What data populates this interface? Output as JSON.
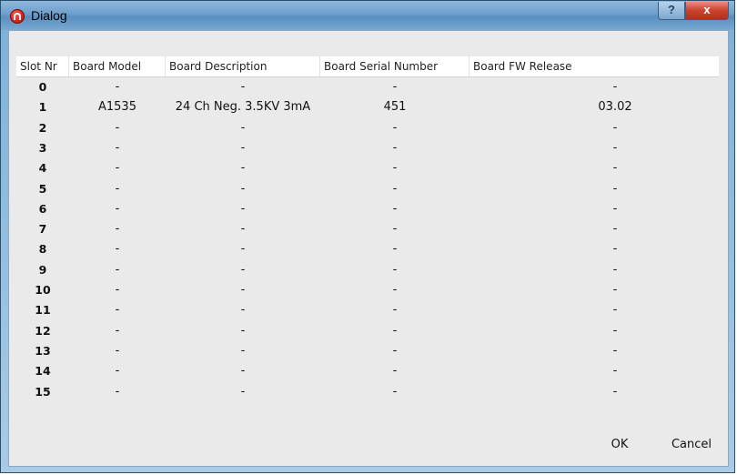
{
  "window": {
    "title": "Dialog",
    "help_label": "?",
    "close_label": "x"
  },
  "table": {
    "columns": [
      "Slot Nr",
      "Board Model",
      "Board Description",
      "Board Serial Number",
      "Board FW Release"
    ],
    "rows": [
      [
        "0",
        "-",
        "-",
        "-",
        "-"
      ],
      [
        "1",
        "A1535",
        "24 Ch Neg. 3.5KV 3mA",
        "451",
        "03.02"
      ],
      [
        "2",
        "-",
        "-",
        "-",
        "-"
      ],
      [
        "3",
        "-",
        "-",
        "-",
        "-"
      ],
      [
        "4",
        "-",
        "-",
        "-",
        "-"
      ],
      [
        "5",
        "-",
        "-",
        "-",
        "-"
      ],
      [
        "6",
        "-",
        "-",
        "-",
        "-"
      ],
      [
        "7",
        "-",
        "-",
        "-",
        "-"
      ],
      [
        "8",
        "-",
        "-",
        "-",
        "-"
      ],
      [
        "9",
        "-",
        "-",
        "-",
        "-"
      ],
      [
        "10",
        "-",
        "-",
        "-",
        "-"
      ],
      [
        "11",
        "-",
        "-",
        "-",
        "-"
      ],
      [
        "12",
        "-",
        "-",
        "-",
        "-"
      ],
      [
        "13",
        "-",
        "-",
        "-",
        "-"
      ],
      [
        "14",
        "-",
        "-",
        "-",
        "-"
      ],
      [
        "15",
        "-",
        "-",
        "-",
        "-"
      ]
    ]
  },
  "buttons": {
    "ok": "OK",
    "cancel": "Cancel"
  },
  "colors": {
    "title_bar": "#6d9fcc",
    "close_button": "#c9432d",
    "dialog_bg": "#eaeaea"
  }
}
